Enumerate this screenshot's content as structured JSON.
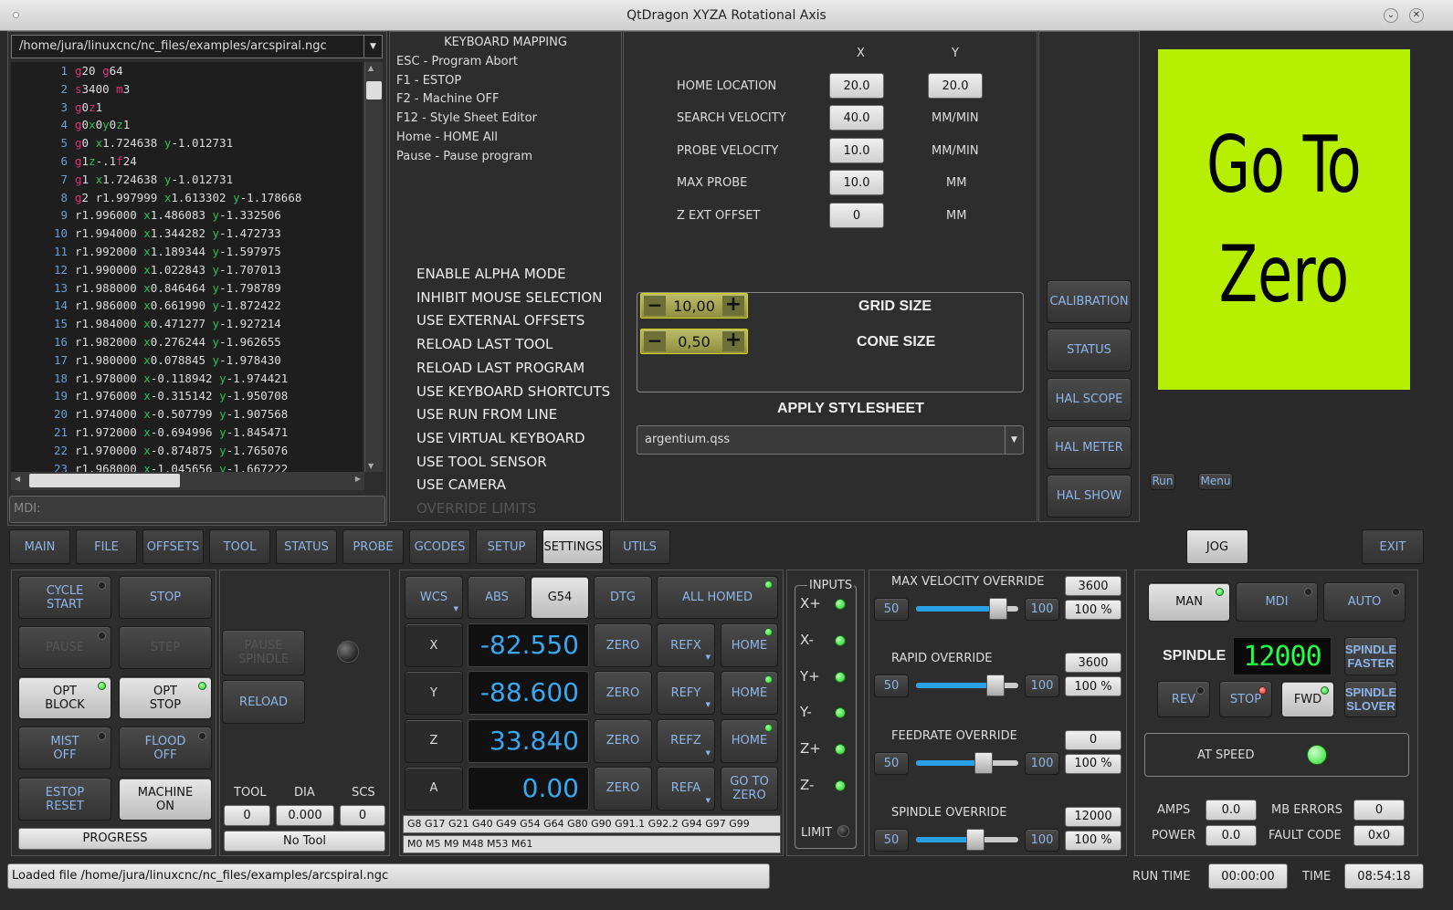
{
  "window": {
    "title": "QtDragon XYZA Rotational Axis"
  },
  "file_path": "/home/jura/linuxcnc/nc_files/examples/arcspiral.ngc",
  "code_lines": [
    {
      "n": "1",
      "parts": [
        [
          "k",
          "g"
        ],
        [
          "",
          "20 "
        ],
        [
          "k",
          "g"
        ],
        [
          "",
          "64"
        ]
      ]
    },
    {
      "n": "2",
      "parts": [
        [
          "k",
          "s"
        ],
        [
          "",
          "3400 "
        ],
        [
          "k",
          "m"
        ],
        [
          "",
          "3"
        ]
      ]
    },
    {
      "n": "3",
      "parts": [
        [
          "k",
          "g"
        ],
        [
          "",
          "0"
        ],
        [
          "k",
          "z"
        ],
        [
          "",
          "1"
        ]
      ]
    },
    {
      "n": "4",
      "parts": [
        [
          "k",
          "g"
        ],
        [
          "",
          "0"
        ],
        [
          "ax",
          "x"
        ],
        [
          "",
          "0"
        ],
        [
          "ax",
          "y"
        ],
        [
          "",
          "0"
        ],
        [
          "ax",
          "z"
        ],
        [
          "",
          "1"
        ]
      ]
    },
    {
      "n": "5",
      "parts": [
        [
          "k",
          "g"
        ],
        [
          "",
          "0 "
        ],
        [
          "ax",
          "x"
        ],
        [
          "",
          "1.724638 "
        ],
        [
          "ax",
          "y"
        ],
        [
          "",
          "-1.012731"
        ]
      ]
    },
    {
      "n": "6",
      "parts": [
        [
          "k",
          "g"
        ],
        [
          "",
          "1"
        ],
        [
          "ax",
          "z"
        ],
        [
          "",
          "-.1"
        ],
        [
          "k",
          "f"
        ],
        [
          "",
          "24"
        ]
      ]
    },
    {
      "n": "7",
      "parts": [
        [
          "k",
          "g"
        ],
        [
          "",
          "1 "
        ],
        [
          "ax",
          "x"
        ],
        [
          "",
          "1.724638 "
        ],
        [
          "ax",
          "y"
        ],
        [
          "",
          "-1.012731"
        ]
      ]
    },
    {
      "n": "8",
      "parts": [
        [
          "k",
          "g"
        ],
        [
          "",
          "2 r1.997999 "
        ],
        [
          "ax",
          "x"
        ],
        [
          "",
          "1.613302 "
        ],
        [
          "ax",
          "y"
        ],
        [
          "",
          "-1.178668"
        ]
      ]
    },
    {
      "n": "9",
      "parts": [
        [
          "",
          "r1.996000 "
        ],
        [
          "ax",
          "x"
        ],
        [
          "",
          "1.486083 "
        ],
        [
          "ax",
          "y"
        ],
        [
          "",
          "-1.332506"
        ]
      ]
    },
    {
      "n": "10",
      "parts": [
        [
          "",
          "r1.994000 "
        ],
        [
          "ax",
          "x"
        ],
        [
          "",
          "1.344282 "
        ],
        [
          "ax",
          "y"
        ],
        [
          "",
          "-1.472733"
        ]
      ]
    },
    {
      "n": "11",
      "parts": [
        [
          "",
          "r1.992000 "
        ],
        [
          "ax",
          "x"
        ],
        [
          "",
          "1.189344 "
        ],
        [
          "ax",
          "y"
        ],
        [
          "",
          "-1.597975"
        ]
      ]
    },
    {
      "n": "12",
      "parts": [
        [
          "",
          "r1.990000 "
        ],
        [
          "ax",
          "x"
        ],
        [
          "",
          "1.022843 "
        ],
        [
          "ax",
          "y"
        ],
        [
          "",
          "-1.707013"
        ]
      ]
    },
    {
      "n": "13",
      "parts": [
        [
          "",
          "r1.988000 "
        ],
        [
          "ax",
          "x"
        ],
        [
          "",
          "0.846464 "
        ],
        [
          "ax",
          "y"
        ],
        [
          "",
          "-1.798789"
        ]
      ]
    },
    {
      "n": "14",
      "parts": [
        [
          "",
          "r1.986000 "
        ],
        [
          "ax",
          "x"
        ],
        [
          "",
          "0.661990 "
        ],
        [
          "ax",
          "y"
        ],
        [
          "",
          "-1.872422"
        ]
      ]
    },
    {
      "n": "15",
      "parts": [
        [
          "",
          "r1.984000 "
        ],
        [
          "ax",
          "x"
        ],
        [
          "",
          "0.471277 "
        ],
        [
          "ax",
          "y"
        ],
        [
          "",
          "-1.927214"
        ]
      ]
    },
    {
      "n": "16",
      "parts": [
        [
          "",
          "r1.982000 "
        ],
        [
          "ax",
          "x"
        ],
        [
          "",
          "0.276244 "
        ],
        [
          "ax",
          "y"
        ],
        [
          "",
          "-1.962655"
        ]
      ]
    },
    {
      "n": "17",
      "parts": [
        [
          "",
          "r1.980000 "
        ],
        [
          "ax",
          "x"
        ],
        [
          "",
          "0.078845 "
        ],
        [
          "ax",
          "y"
        ],
        [
          "",
          "-1.978430"
        ]
      ]
    },
    {
      "n": "18",
      "parts": [
        [
          "",
          "r1.978000 "
        ],
        [
          "ax",
          "x"
        ],
        [
          "",
          "-0.118942 "
        ],
        [
          "ax",
          "y"
        ],
        [
          "",
          "-1.974421"
        ]
      ]
    },
    {
      "n": "19",
      "parts": [
        [
          "",
          "r1.976000 "
        ],
        [
          "ax",
          "x"
        ],
        [
          "",
          "-0.315142 "
        ],
        [
          "ax",
          "y"
        ],
        [
          "",
          "-1.950708"
        ]
      ]
    },
    {
      "n": "20",
      "parts": [
        [
          "",
          "r1.974000 "
        ],
        [
          "ax",
          "x"
        ],
        [
          "",
          "-0.507799 "
        ],
        [
          "ax",
          "y"
        ],
        [
          "",
          "-1.907568"
        ]
      ]
    },
    {
      "n": "21",
      "parts": [
        [
          "",
          "r1.972000 "
        ],
        [
          "ax",
          "x"
        ],
        [
          "",
          "-0.694996 "
        ],
        [
          "ax",
          "y"
        ],
        [
          "",
          "-1.845471"
        ]
      ]
    },
    {
      "n": "22",
      "parts": [
        [
          "",
          "r1.970000 "
        ],
        [
          "ax",
          "x"
        ],
        [
          "",
          "-0.874875 "
        ],
        [
          "ax",
          "y"
        ],
        [
          "",
          "-1.765076"
        ]
      ]
    },
    {
      "n": "23",
      "parts": [
        [
          "",
          "r1.968000 "
        ],
        [
          "ax",
          "x"
        ],
        [
          "",
          "-1.045656 "
        ],
        [
          "ax",
          "y"
        ],
        [
          "",
          "-1.667222"
        ]
      ]
    }
  ],
  "mdi_placeholder": "MDI:",
  "keyboard": {
    "title": "KEYBOARD MAPPING",
    "lines": [
      "ESC - Program Abort",
      "F1 - ESTOP",
      "F2 - Machine OFF",
      "F12 - Style Sheet Editor",
      "Home - HOME All",
      "Pause - Pause program"
    ]
  },
  "options": [
    "ENABLE ALPHA MODE",
    "INHIBIT MOUSE SELECTION",
    "USE EXTERNAL OFFSETS",
    "RELOAD LAST TOOL",
    "RELOAD LAST PROGRAM",
    "USE KEYBOARD SHORTCUTS",
    "USE RUN FROM LINE",
    "USE VIRTUAL KEYBOARD",
    "USE TOOL SENSOR",
    "USE CAMERA",
    "OVERRIDE LIMITS"
  ],
  "probe": {
    "col_x": "X",
    "col_y": "Y",
    "home_label": "HOME LOCATION",
    "home_x": "20.0",
    "home_y": "20.0",
    "search_label": "SEARCH VELOCITY",
    "search_val": "40.0",
    "search_unit": "MM/MIN",
    "probe_label": "PROBE VELOCITY",
    "probe_val": "10.0",
    "probe_unit": "MM/MIN",
    "max_label": "MAX PROBE",
    "max_val": "10.0",
    "max_unit": "MM",
    "zext_label": "Z EXT OFFSET",
    "zext_val": "0",
    "zext_unit": "MM"
  },
  "grid": {
    "grid_val": "10,00",
    "grid_label": "GRID SIZE",
    "cone_val": "0,50",
    "cone_label": "CONE SIZE",
    "minus": "−",
    "plus": "+"
  },
  "stylesheet": {
    "label": "APPLY STYLESHEET",
    "value": "argentium.qss"
  },
  "side_buttons": [
    "CALIBRATION",
    "STATUS",
    "HAL SCOPE",
    "HAL METER",
    "HAL SHOW"
  ],
  "camera": {
    "line1": "Go To",
    "line2": "Zero",
    "run": "Run",
    "menu": "Menu",
    "bg": "#b6f000"
  },
  "tabs": [
    "MAIN",
    "FILE",
    "OFFSETS",
    "TOOL",
    "STATUS",
    "PROBE",
    "GCODES",
    "SETUP",
    "SETTINGS",
    "UTILS"
  ],
  "jog": "JOG",
  "exit": "EXIT",
  "controls": {
    "cycle_start": "CYCLE\nSTART",
    "stop": "STOP",
    "pause": "PAUSE",
    "step": "STEP",
    "opt_block": "OPT\nBLOCK",
    "opt_stop": "OPT\nSTOP",
    "mist": "MIST\nOFF",
    "flood": "FLOOD\nOFF",
    "estop": "ESTOP\nRESET",
    "machine": "MACHINE\nON",
    "progress": "PROGRESS"
  },
  "mid": {
    "pause_spindle": "PAUSE\nSPINDLE",
    "reload": "RELOAD",
    "tool_h": "TOOL",
    "dia_h": "DIA",
    "scs_h": "SCS",
    "tool": "0",
    "dia": "0.000",
    "scs": "0",
    "no_tool": "No Tool"
  },
  "dro": {
    "wcs": "WCS",
    "abs": "ABS",
    "g54": "G54",
    "dtg": "DTG",
    "all_homed": "ALL HOMED",
    "axes": [
      {
        "name": "X",
        "val": "-82.550",
        "ref": "REFX",
        "home": "HOME"
      },
      {
        "name": "Y",
        "val": "-88.600",
        "ref": "REFY",
        "home": "HOME"
      },
      {
        "name": "Z",
        "val": "33.840",
        "ref": "REFZ",
        "home": "HOME"
      },
      {
        "name": "A",
        "val": "0.00",
        "ref": "REFA",
        "home": "GO TO\nZERO"
      }
    ],
    "zero": "ZERO",
    "gcodes": "G8 G17 G21 G40 G49 G54 G64 G80 G90 G91.1 G92.2 G94 G97 G99",
    "mcodes": "M0 M5 M9 M48 M53 M61"
  },
  "inputs": {
    "title": "INPUTS",
    "items": [
      "X+",
      "X-",
      "Y+",
      "Y-",
      "Z+",
      "Z-"
    ],
    "limit": "LIMIT"
  },
  "overrides": [
    {
      "label": "MAX VELOCITY OVERRIDE",
      "val": "3600",
      "pct": "100 %",
      "min": "50",
      "max": "100",
      "fill": 0.8
    },
    {
      "label": "RAPID OVERRIDE",
      "val": "3600",
      "pct": "100 %",
      "min": "50",
      "max": "100",
      "fill": 0.78
    },
    {
      "label": "FEEDRATE OVERRIDE",
      "val": "0",
      "pct": "100 %",
      "min": "50",
      "max": "100",
      "fill": 0.66
    },
    {
      "label": "SPINDLE OVERRIDE",
      "val": "12000",
      "pct": "100 %",
      "min": "50",
      "max": "100",
      "fill": 0.58
    }
  ],
  "spindle": {
    "man": "MAN",
    "mdi": "MDI",
    "auto": "AUTO",
    "label": "SPINDLE",
    "rpm": "12000",
    "faster": "SPINDLE\nFASTER",
    "slower": "SPINDLE\nSLOVER",
    "rev": "REV",
    "stop": "STOP",
    "fwd": "FWD",
    "at_speed": "AT SPEED",
    "amps_l": "AMPS",
    "amps": "0.0",
    "mb_l": "MB ERRORS",
    "mb": "0",
    "power_l": "POWER",
    "power": "0.0",
    "fault_l": "FAULT CODE",
    "fault": "0x0"
  },
  "status": {
    "message": "Loaded file /home/jura/linuxcnc/nc_files/examples/arcspiral.ngc",
    "run_time_l": "RUN TIME",
    "run_time": "00:00:00",
    "time_l": "TIME",
    "time": "08:54:18"
  }
}
